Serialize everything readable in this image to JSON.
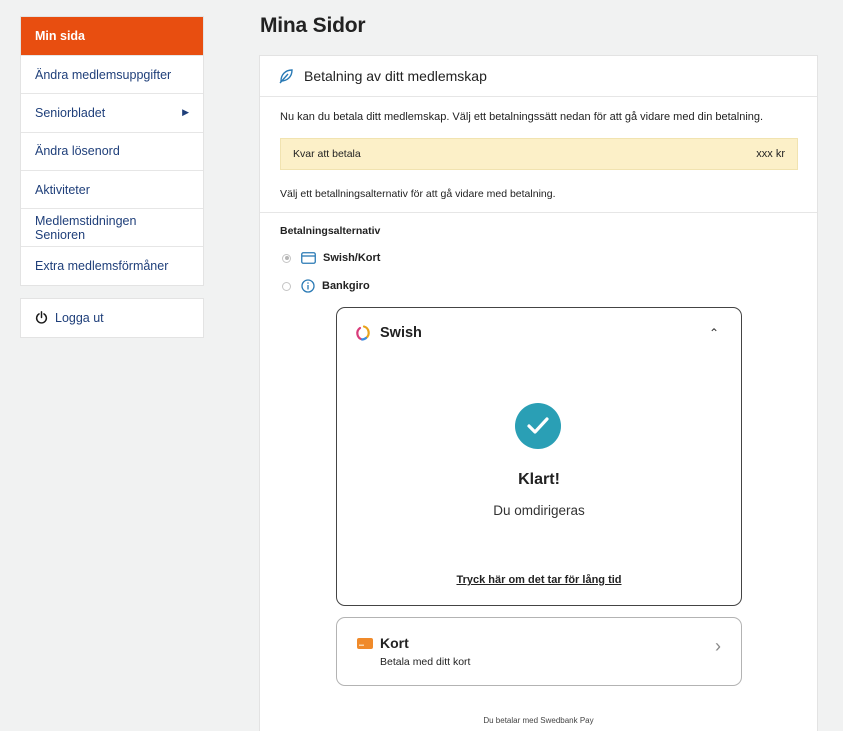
{
  "sidebar": {
    "items": [
      {
        "label": "Min sida"
      },
      {
        "label": "Ändra medlemsuppgifter"
      },
      {
        "label": "Seniorbladet"
      },
      {
        "label": "Ändra lösenord"
      },
      {
        "label": "Aktiviteter"
      },
      {
        "label": "Medlemstidningen Senioren"
      },
      {
        "label": "Extra medlemsförmåner"
      }
    ],
    "logout_label": "Logga ut"
  },
  "page": {
    "title": "Mina Sidor"
  },
  "payment": {
    "heading": "Betalning av ditt medlemskap",
    "intro": "Nu kan du betala ditt medlemskap. Välj ett betalningssätt nedan för att gå vidare med din betalning.",
    "due_label": "Kvar att betala",
    "due_amount": "xxx  kr",
    "choose_text": "Välj ett betallningsalternativ för att gå vidare med betalning.",
    "options_label": "Betalningsalternativ",
    "options": [
      {
        "label": "Swish/Kort",
        "selected": true
      },
      {
        "label": "Bankgiro",
        "selected": false
      }
    ]
  },
  "swish": {
    "name": "Swish",
    "status": "Klart!",
    "redirect_text": "Du omdirigeras",
    "slow_link": "Tryck här om det tar för lång tid"
  },
  "card": {
    "title": "Kort",
    "subtitle": "Betala med ditt kort"
  },
  "footer": {
    "provider_note": "Du betalar med Swedbank Pay"
  },
  "colors": {
    "accent": "#e84e10",
    "link": "#1f3f7a",
    "check": "#2a9fb5",
    "due_bg": "#fcf0c8"
  }
}
